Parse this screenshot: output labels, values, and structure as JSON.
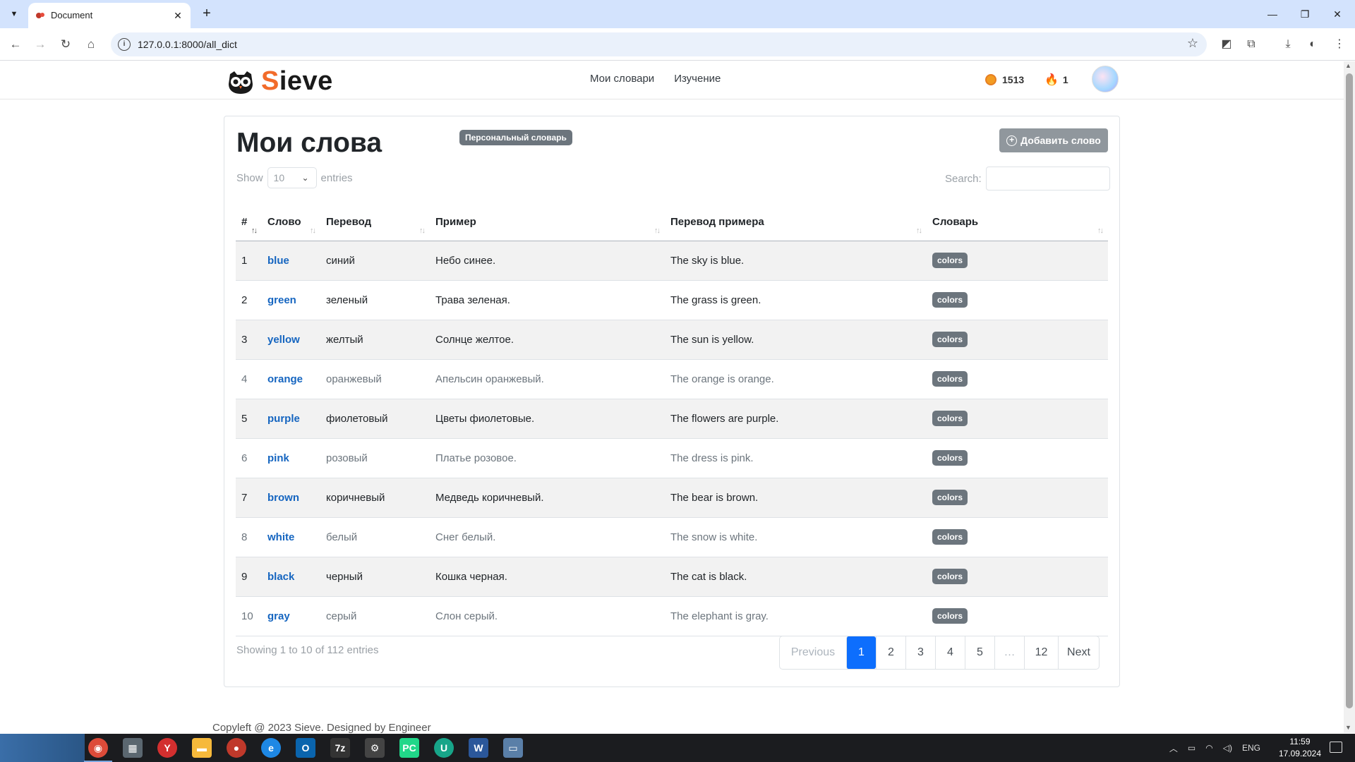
{
  "browser": {
    "tab_title": "Document",
    "url": "127.0.0.1:8000/all_dict"
  },
  "site": {
    "brand_first": "S",
    "brand_rest": "ieve",
    "nav": [
      "Мои словари",
      "Изучение"
    ],
    "coins": "1513",
    "streak": "1"
  },
  "page": {
    "title": "Мои слова",
    "badge": "Персональный словарь",
    "add_button": "Добавить слово",
    "show_label": "Show",
    "entries_label": "entries",
    "length_value": "10",
    "search_label": "Search:",
    "info": "Showing 1 to 10 of 112 entries",
    "footer": "Copyleft @ 2023 Sieve. Designed by Engineer"
  },
  "table": {
    "headers": [
      "#",
      "Слово",
      "Перевод",
      "Пример",
      "Перевод примера",
      "Словарь"
    ],
    "rows": [
      {
        "num": "1",
        "word": "blue",
        "translation": "синий",
        "example": "Небо синее.",
        "example_translation": "The sky is blue.",
        "dict": "colors"
      },
      {
        "num": "2",
        "word": "green",
        "translation": "зеленый",
        "example": "Трава зеленая.",
        "example_translation": "The grass is green.",
        "dict": "colors"
      },
      {
        "num": "3",
        "word": "yellow",
        "translation": "желтый",
        "example": "Солнце желтое.",
        "example_translation": "The sun is yellow.",
        "dict": "colors"
      },
      {
        "num": "4",
        "word": "orange",
        "translation": "оранжевый",
        "example": "Апельсин оранжевый.",
        "example_translation": "The orange is orange.",
        "dict": "colors"
      },
      {
        "num": "5",
        "word": "purple",
        "translation": "фиолетовый",
        "example": "Цветы фиолетовые.",
        "example_translation": "The flowers are purple.",
        "dict": "colors"
      },
      {
        "num": "6",
        "word": "pink",
        "translation": "розовый",
        "example": "Платье розовое.",
        "example_translation": "The dress is pink.",
        "dict": "colors"
      },
      {
        "num": "7",
        "word": "brown",
        "translation": "коричневый",
        "example": "Медведь коричневый.",
        "example_translation": "The bear is brown.",
        "dict": "colors"
      },
      {
        "num": "8",
        "word": "white",
        "translation": "белый",
        "example": "Снег белый.",
        "example_translation": "The snow is white.",
        "dict": "colors"
      },
      {
        "num": "9",
        "word": "black",
        "translation": "черный",
        "example": "Кошка черная.",
        "example_translation": "The cat is black.",
        "dict": "colors"
      },
      {
        "num": "10",
        "word": "gray",
        "translation": "серый",
        "example": "Слон серый.",
        "example_translation": "The elephant is gray.",
        "dict": "colors"
      }
    ]
  },
  "pagination": {
    "previous": "Previous",
    "pages": [
      "1",
      "2",
      "3",
      "4",
      "5",
      "…",
      "12"
    ],
    "next": "Next",
    "current": "1"
  },
  "taskbar": {
    "lang": "ENG",
    "time": "11:59",
    "date": "17.09.2024"
  },
  "colors": {
    "accent": "#0d6efd",
    "brand": "#f26b2a",
    "link": "#1565c0",
    "badge": "#6c757d"
  }
}
